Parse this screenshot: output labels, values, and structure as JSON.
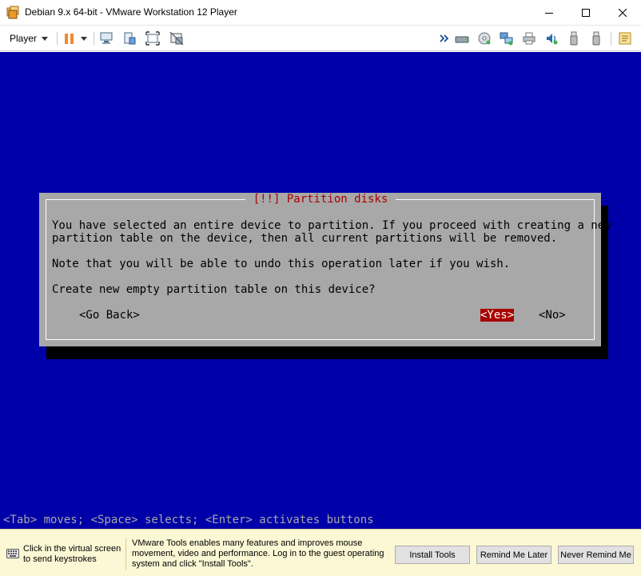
{
  "window": {
    "title": "Debian 9.x 64-bit - VMware Workstation 12 Player"
  },
  "toolbar": {
    "player_menu_label": "Player"
  },
  "dialog": {
    "title": "[!!] Partition disks",
    "paragraph1": [
      "You have selected an entire device to partition. If you proceed with creating a new",
      "partition table on the device, then all current partitions will be removed."
    ],
    "paragraph2": "Note that you will be able to undo this operation later if you wish.",
    "question": "Create new empty partition table on this device?",
    "buttons": {
      "go_back": "<Go Back>",
      "yes": "<Yes>",
      "no": "<No>"
    },
    "selected_button": "yes"
  },
  "console": {
    "hint": "<Tab> moves; <Space> selects; <Enter> activates buttons"
  },
  "infobar": {
    "left_text": "Click in the virtual screen to send keystrokes",
    "message": "VMware Tools enables many features and improves mouse movement, video and performance. Log in to the guest operating system and click \"Install Tools\".",
    "install_tools_label": "Install Tools",
    "remind_later_label": "Remind Me Later",
    "never_remind_label": "Never Remind Me"
  },
  "colors": {
    "console_background": "#0000a8",
    "dialog_background": "#a8a8a8",
    "dialog_title": "#a80000",
    "selected_button_bg": "#a80000",
    "infobar_background": "#fcf8d5",
    "pause_icon": "#f08a2c"
  },
  "icons": {
    "app": "vmware-player-icon",
    "pause": "pause-icon",
    "send_ctrl_alt_del": "ctrl-alt-del-icon",
    "unity": "unity-icon",
    "full_screen": "full-screen-icon",
    "no_unity": "exit-unity-icon",
    "expand": "double-chevron-right-icon",
    "devices": [
      "hard-disk-icon",
      "cd-dvd-icon",
      "network-adapter-icon",
      "printer-icon",
      "sound-card-icon",
      "usb-device-icon",
      "usb-device-2-icon",
      "message-log-icon"
    ]
  }
}
